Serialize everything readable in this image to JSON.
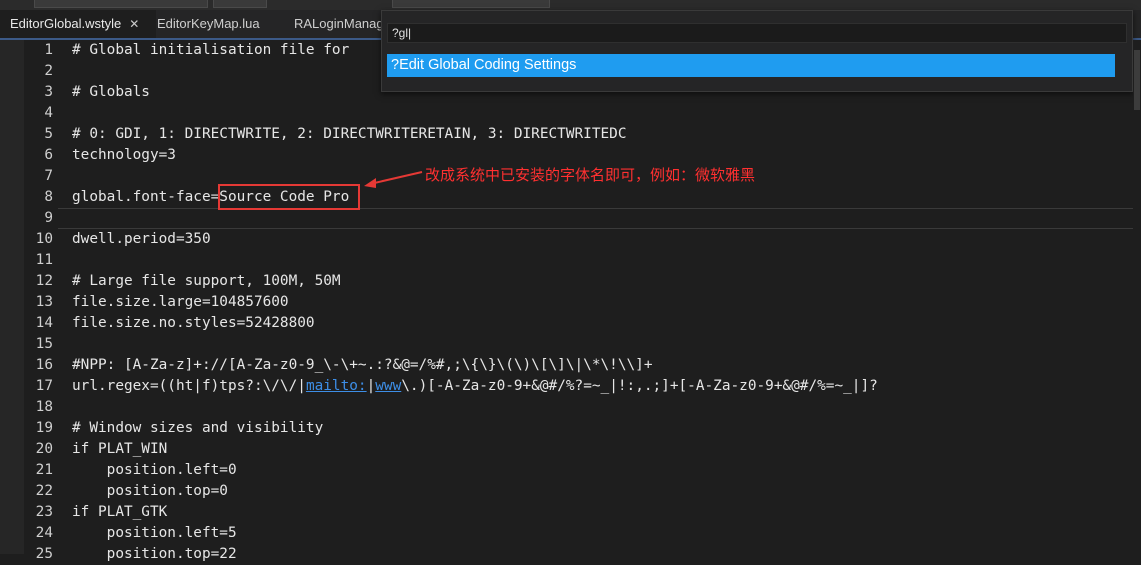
{
  "tabs": [
    {
      "label": "EditorGlobal.wstyle",
      "active": true
    },
    {
      "label": "EditorKeyMap.lua",
      "active": false
    },
    {
      "label": "RALoginManag",
      "active": false
    }
  ],
  "close_glyph": "✕",
  "palette": {
    "query": "?gl|",
    "items": [
      {
        "label": "?Edit Global Coding Settings",
        "selected": true
      }
    ]
  },
  "lines": [
    {
      "n": "1",
      "t": "# Global initialisation file for",
      "kind": "comment"
    },
    {
      "n": "2",
      "t": "",
      "kind": "plain"
    },
    {
      "n": "3",
      "t": "# Globals",
      "kind": "comment"
    },
    {
      "n": "4",
      "t": "",
      "kind": "plain"
    },
    {
      "n": "5",
      "t": "# 0: GDI, 1: DIRECTWRITE, 2: DIRECTWRITERETAIN, 3: DIRECTWRITEDC",
      "kind": "comment"
    },
    {
      "n": "6",
      "t": "technology=3",
      "kind": "plain"
    },
    {
      "n": "7",
      "t": "",
      "kind": "plain"
    },
    {
      "n": "8",
      "t": "global.font-face=Source Code Pro",
      "kind": "plain"
    },
    {
      "n": "9",
      "t": "",
      "kind": "plain"
    },
    {
      "n": "10",
      "t": "dwell.period=350",
      "kind": "plain"
    },
    {
      "n": "11",
      "t": "",
      "kind": "plain"
    },
    {
      "n": "12",
      "t": "# Large file support, 100M, 50M",
      "kind": "comment"
    },
    {
      "n": "13",
      "t": "file.size.large=104857600",
      "kind": "plain"
    },
    {
      "n": "14",
      "t": "file.size.no.styles=52428800",
      "kind": "plain"
    },
    {
      "n": "15",
      "t": "",
      "kind": "plain"
    },
    {
      "n": "16",
      "t": "#NPP: [A-Za-z]+://[A-Za-z0-9_\\-\\+~.:?&@=/%#,;\\{\\}\\(\\)\\[\\]\\|\\*\\!\\\\]+",
      "kind": "comment"
    },
    {
      "n": "17",
      "kind": "url",
      "pre": "url.regex=((ht|f)tps?:\\/\\/|",
      "link1": "mailto:",
      "mid": "|",
      "link2": "www",
      "post": "\\.)[-A-Za-z0-9+&@#/%?=~_|!:,.;]+[-A-Za-z0-9+&@#/%=~_|]?"
    },
    {
      "n": "18",
      "t": "",
      "kind": "plain"
    },
    {
      "n": "19",
      "t": "# Window sizes and visibility",
      "kind": "comment"
    },
    {
      "n": "20",
      "t": "if PLAT_WIN",
      "kind": "plain"
    },
    {
      "n": "21",
      "t": "    position.left=0",
      "kind": "plain"
    },
    {
      "n": "22",
      "t": "    position.top=0",
      "kind": "plain"
    },
    {
      "n": "23",
      "t": "if PLAT_GTK",
      "kind": "plain"
    },
    {
      "n": "24",
      "t": "    position.left=5",
      "kind": "plain"
    },
    {
      "n": "25",
      "t": "    position.top=22",
      "kind": "plain"
    }
  ],
  "annotation": {
    "text": "改成系统中已安装的字体名即可，例如：微软雅黑"
  },
  "colors": {
    "comment": "#2aa198",
    "text": "#e6e6e6",
    "link": "#3d8ee6",
    "selection": "#1f9cf0",
    "annotation": "#ff3030"
  }
}
